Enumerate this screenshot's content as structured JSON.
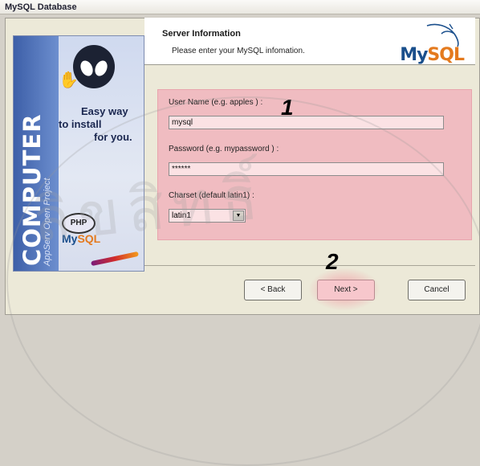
{
  "window": {
    "title": "MySQL Database"
  },
  "header": {
    "title": "Server Information",
    "subtitle": "Please enter your MySQL infomation.",
    "logo_text_my": "My",
    "logo_text_sql": "SQL"
  },
  "banner": {
    "vertical_title": "COMPUTER",
    "vertical_subtitle": "AppServ Open Project",
    "tagline_1": "Easy way",
    "tagline_2": "to install",
    "tagline_3": "for you.",
    "php_badge": "PHP",
    "mysql_my": "My",
    "mysql_sql": "SQL"
  },
  "form": {
    "username_label": "User Name (e.g. apples ) :",
    "username_value": "mysql",
    "password_label": "Password (e.g. mypassword ) :",
    "password_value": "******",
    "charset_label": "Charset (default latin1) :",
    "charset_value": "latin1"
  },
  "annotations": {
    "step1": "1",
    "step2": "2"
  },
  "buttons": {
    "back": "< Back",
    "next": "Next >",
    "cancel": "Cancel"
  },
  "watermark": {
    "text": "ลิขสิทธิ์"
  },
  "colors": {
    "highlight": "#f0bcc1",
    "mysql_blue": "#1a4f8c",
    "mysql_orange": "#e47a1e"
  }
}
